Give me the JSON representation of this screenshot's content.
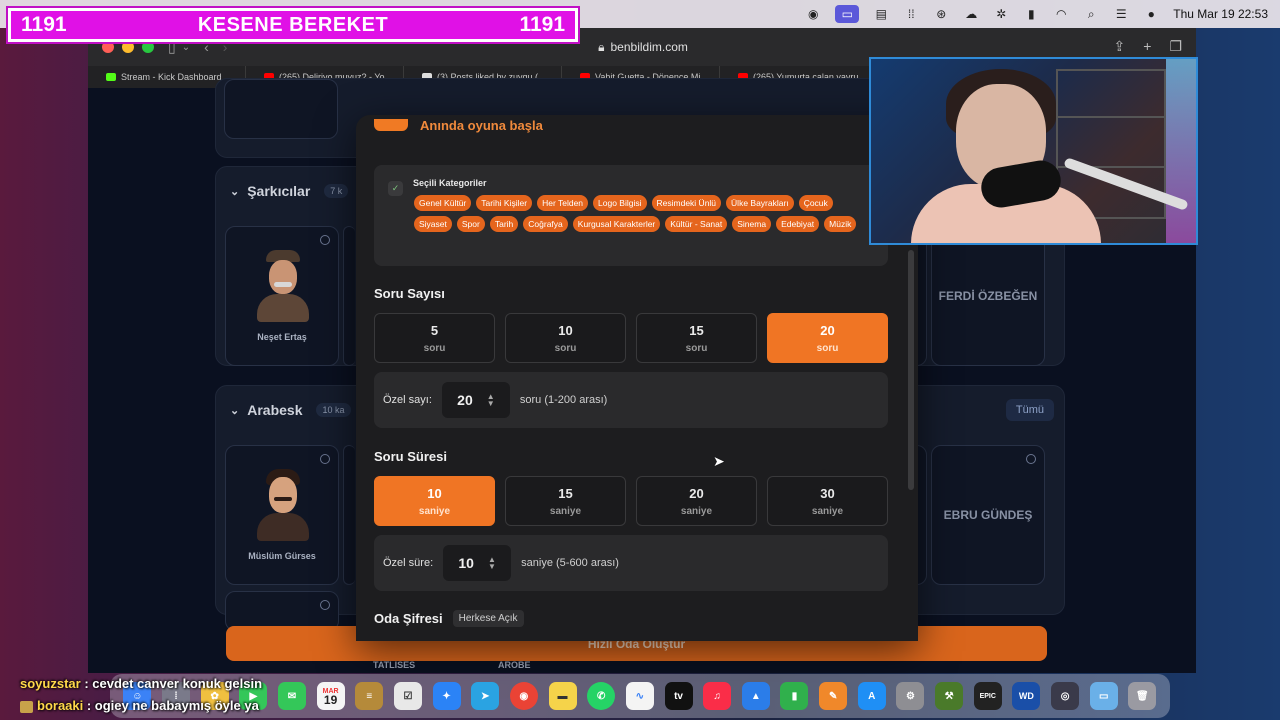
{
  "menubar": {
    "datetime": "Thu Mar 19  22:53"
  },
  "banner": {
    "left_count": "1191",
    "title": "KESENE BEREKET",
    "right_count": "1191"
  },
  "browser": {
    "url": "benbildim.com",
    "tabs": [
      {
        "label": "Stream - Kick Dashboard",
        "color": "#53fc18"
      },
      {
        "label": "(265) Deliriyo muyuz? - Yo...",
        "color": "#ff0000"
      },
      {
        "label": "(3) Posts liked by zuygu (...",
        "color": "#ffffff"
      },
      {
        "label": "Vahit Guetta - Dönence Mi...",
        "color": "#ff0000"
      },
      {
        "label": "(265) Yumurta çalan yavru...",
        "color": "#ff0000"
      }
    ]
  },
  "background": {
    "section1": {
      "title": "Şarkıcılar",
      "badge": "7 k",
      "card1": "Neşet Ertaş",
      "card_right": "FERDİ ÖZBEĞEN"
    },
    "section2": {
      "title": "Arabesk",
      "badge": "10 ka",
      "tumu": "Tümü",
      "card1": "Müslüm Gürses",
      "card_right": "EBRU GÜNDEŞ"
    },
    "create_button": "Hızlı Oda Oluştur",
    "bottom_labels": [
      "TATLISES",
      "AROBE"
    ]
  },
  "modal": {
    "header": "Anında oyuna başla",
    "categories_label": "Seçili Kategoriler",
    "categories": [
      "Genel Kültür",
      "Tarihi Kişiler",
      "Her Telden",
      "Logo Bilgisi",
      "Resimdeki Ünlü",
      "Ülke Bayrakları",
      "Çocuk",
      "Siyaset",
      "Spor",
      "Tarih",
      "Coğrafya",
      "Kurgusal Karakterler",
      "Kültür - Sanat",
      "Sinema",
      "Edebiyat",
      "Müzik"
    ],
    "question_count": {
      "title": "Soru Sayısı",
      "options": [
        {
          "value": "5",
          "unit": "soru"
        },
        {
          "value": "10",
          "unit": "soru"
        },
        {
          "value": "15",
          "unit": "soru"
        },
        {
          "value": "20",
          "unit": "soru"
        }
      ],
      "selected": "20",
      "custom_label": "Özel sayı:",
      "custom_value": "20",
      "custom_hint": "soru (1-200 arası)"
    },
    "question_time": {
      "title": "Soru Süresi",
      "options": [
        {
          "value": "10",
          "unit": "saniye"
        },
        {
          "value": "15",
          "unit": "saniye"
        },
        {
          "value": "20",
          "unit": "saniye"
        },
        {
          "value": "30",
          "unit": "saniye"
        }
      ],
      "selected": "10",
      "custom_label": "Özel süre:",
      "custom_value": "10",
      "custom_hint": "saniye (5-600 arası)"
    },
    "room_password": {
      "title": "Oda Şifresi",
      "badge": "Herkese Açık"
    }
  },
  "chat": [
    {
      "user": "soyuzstar",
      "message": " : cevdet canver konuk gelsin"
    },
    {
      "user": "boraaki",
      "message": " : ogiey ne babaymış öyle ya"
    }
  ],
  "dock": {
    "calendar_month": "MAR",
    "calendar_day": "19",
    "apps": [
      "finder",
      "launchpad",
      "photos",
      "facetime",
      "messages",
      "calendar",
      "notes",
      "reminders",
      "safari",
      "telegram",
      "chrome",
      "notes-yellow",
      "whatsapp",
      "freeform",
      "apple-tv",
      "music",
      "keynote",
      "numbers",
      "pages",
      "app-store",
      "system-settings",
      "xcode",
      "epic-games",
      "wd",
      "disk-utility",
      "folder",
      "trash"
    ]
  },
  "colors": {
    "accent": "#f07524",
    "banner": "#e011e6",
    "modal_bg": "#1d1d1f"
  }
}
